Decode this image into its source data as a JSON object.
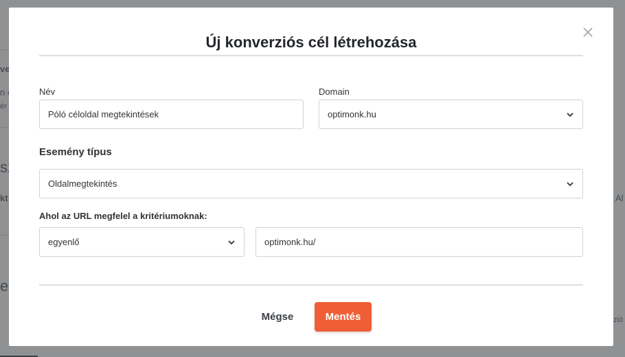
{
  "background": {
    "fragments": [
      "ve",
      "n é",
      "ér",
      "sz",
      "kt",
      "es",
      "Al",
      "zió"
    ]
  },
  "modal": {
    "title": "Új konverziós cél létrehozása",
    "close_icon": "close-icon"
  },
  "form": {
    "name": {
      "label": "Név",
      "value": "Póló céloldal megtekintések"
    },
    "domain": {
      "label": "Domain",
      "value": "optimonk.hu"
    },
    "event_type": {
      "label": "Esemény típus",
      "value": "Oldalmegtekintés"
    },
    "url_criteria": {
      "label": "Ahol az URL megfelel a kritériumoknak:",
      "operator": "egyenlő",
      "value": "optimonk.hu/"
    }
  },
  "footer": {
    "cancel_label": "Mégse",
    "save_label": "Mentés"
  },
  "colors": {
    "accent": "#ef5e35",
    "overlay": "#8f9193"
  }
}
